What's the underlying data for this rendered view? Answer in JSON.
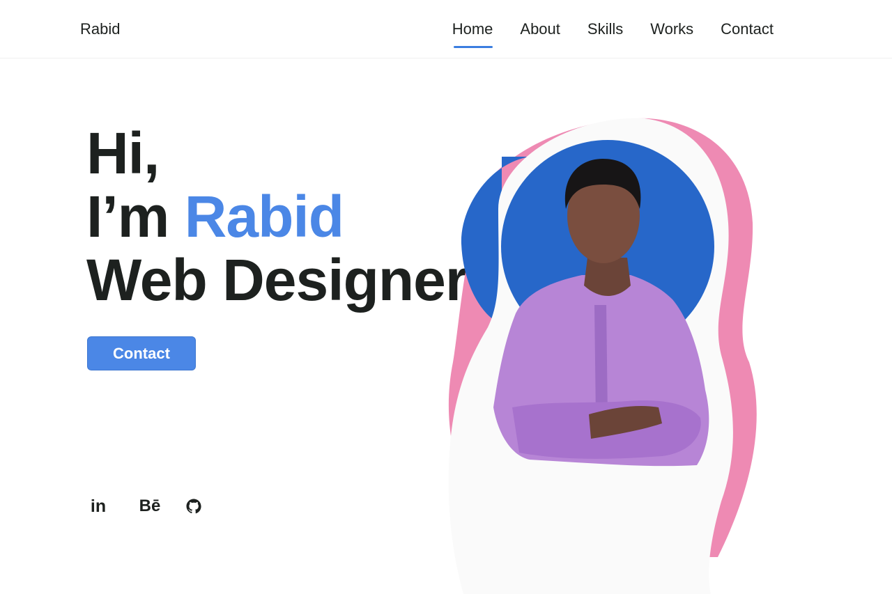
{
  "header": {
    "logo": "Rabid",
    "nav": [
      {
        "label": "Home",
        "active": true
      },
      {
        "label": "About",
        "active": false
      },
      {
        "label": "Skills",
        "active": false
      },
      {
        "label": "Works",
        "active": false
      },
      {
        "label": "Contact",
        "active": false
      }
    ]
  },
  "hero": {
    "line1": "Hi,",
    "line2_prefix": "I’m ",
    "line2_name": "Rabid",
    "line3": "Web Designer",
    "cta_label": "Contact"
  },
  "social": {
    "linkedin_label": "in",
    "behance_label": "Bē",
    "icons": [
      "linkedin-icon",
      "behance-icon",
      "github-icon"
    ]
  },
  "colors": {
    "accent": "#4b87e6",
    "text": "#1d211f",
    "blob_blue": "#2767c9",
    "blob_pink": "#ee8ab3",
    "shirt": "#b785d6"
  }
}
